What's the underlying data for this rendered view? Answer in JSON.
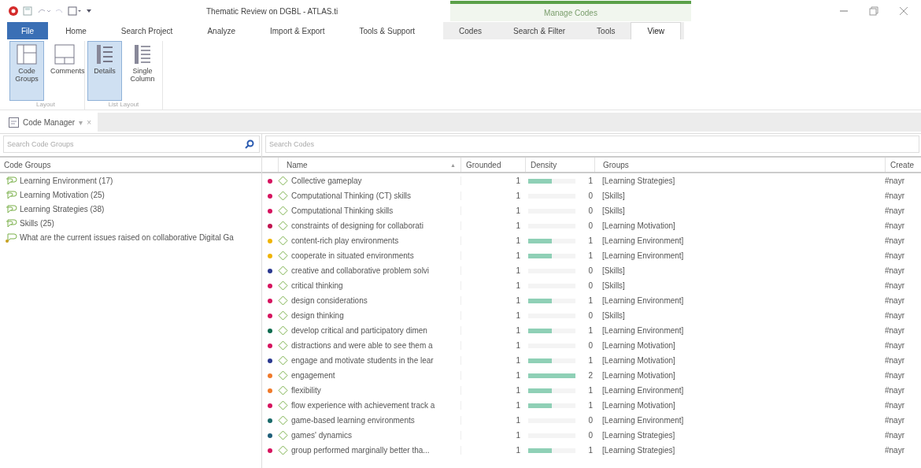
{
  "window": {
    "title": "Thematic Review on DGBL - ATLAS.ti"
  },
  "ribbon_tabs": [
    {
      "label": "File",
      "kind": "file",
      "selected": false
    },
    {
      "label": "Home",
      "kind": "tab",
      "selected": false
    },
    {
      "label": "Search Project",
      "kind": "tab",
      "selected": false
    },
    {
      "label": "Analyze",
      "kind": "tab",
      "selected": false
    },
    {
      "label": "Import & Export",
      "kind": "tab",
      "selected": false
    },
    {
      "label": "Tools & Support",
      "kind": "tab",
      "selected": false
    },
    {
      "label": "Codes",
      "kind": "context",
      "selected": false
    },
    {
      "label": "Search & Filter",
      "kind": "context",
      "selected": false
    },
    {
      "label": "Tools",
      "kind": "context",
      "selected": false
    },
    {
      "label": "View",
      "kind": "context",
      "selected": true
    }
  ],
  "context_group": "Manage Codes",
  "ribbon_groups": [
    {
      "label": "Layout",
      "buttons": [
        {
          "label": "Code Groups",
          "selected": true
        },
        {
          "label": "Comments",
          "selected": false
        }
      ]
    },
    {
      "label": "List Layout",
      "buttons": [
        {
          "label": "Details",
          "selected": true
        },
        {
          "label": "Single Column",
          "selected": false
        }
      ]
    }
  ],
  "document_tab": {
    "label": "Code Manager",
    "pin": "▾",
    "close": "×"
  },
  "code_groups_panel": {
    "search": {
      "placeholder": "Search Code Groups"
    },
    "column": "Code Groups",
    "items": [
      {
        "label": "Learning Environment (17)",
        "kind": "group"
      },
      {
        "label": "Learning Motivation (25)",
        "kind": "group"
      },
      {
        "label": "Learning Strategies (38)",
        "kind": "group"
      },
      {
        "label": "Skills (25)",
        "kind": "group"
      },
      {
        "label": "What are the current issues raised on collaborative Digital Ga",
        "kind": "smart"
      }
    ]
  },
  "codes_panel": {
    "search": {
      "placeholder": "Search Codes"
    },
    "columns": [
      {
        "label": "Name",
        "sort": "▲"
      },
      {
        "label": "Grounded"
      },
      {
        "label": "Density"
      },
      {
        "label": "Groups"
      },
      {
        "label": "Create"
      }
    ],
    "rows": [
      {
        "color": "#d6145f",
        "name": "Collective gameplay",
        "grounded": "1",
        "level": 0.5,
        "density": "1",
        "groups": "[Learning Strategies]",
        "creator": "#nayr"
      },
      {
        "color": "#d6145f",
        "name": "Computational Thinking (CT) skills",
        "grounded": "1",
        "density": "0",
        "groups": "[Skills]",
        "creator": "#nayr"
      },
      {
        "color": "#d6145f",
        "name": "Computational Thinking skills",
        "grounded": "1",
        "density": "0",
        "groups": "[Skills]",
        "creator": "#nayr"
      },
      {
        "color": "#c0144f",
        "name": "constraints of designing for collaborati",
        "grounded": "1",
        "density": "0",
        "groups": "[Learning Motivation]",
        "creator": "#nayr"
      },
      {
        "color": "#f0b400",
        "name": "content-rich play environments",
        "grounded": "1",
        "level": 0.5,
        "density": "1",
        "groups": "[Learning Environment]",
        "creator": "#nayr"
      },
      {
        "color": "#f0b400",
        "name": "cooperate in situated environments",
        "grounded": "1",
        "level": 0.5,
        "density": "1",
        "groups": "[Learning Environment]",
        "creator": "#nayr"
      },
      {
        "color": "#2b3990",
        "name": "creative and collaborative problem solvi",
        "grounded": "1",
        "density": "0",
        "groups": "[Skills]",
        "creator": "#nayr"
      },
      {
        "color": "#d6145f",
        "name": "critical thinking",
        "grounded": "1",
        "density": "0",
        "groups": "[Skills]",
        "creator": "#nayr"
      },
      {
        "color": "#d6145f",
        "name": "design considerations",
        "grounded": "1",
        "level": 0.5,
        "density": "1",
        "groups": "[Learning Environment]",
        "creator": "#nayr"
      },
      {
        "color": "#d6145f",
        "name": "design thinking",
        "grounded": "1",
        "density": "0",
        "groups": "[Skills]",
        "creator": "#nayr"
      },
      {
        "color": "#0f6b4f",
        "name": "develop critical and participatory dimen",
        "grounded": "1",
        "level": 0.5,
        "density": "1",
        "groups": "[Learning Environment]",
        "creator": "#nayr"
      },
      {
        "color": "#d6145f",
        "name": "distractions and were able to see them a",
        "grounded": "1",
        "density": "0",
        "groups": "[Learning Motivation]",
        "creator": "#nayr"
      },
      {
        "color": "#2b3990",
        "name": "engage and motivate students in the lear",
        "grounded": "1",
        "level": 0.5,
        "density": "1",
        "groups": "[Learning Motivation]",
        "creator": "#nayr"
      },
      {
        "color": "#f07a2a",
        "name": "engagement",
        "grounded": "1",
        "level": 1,
        "density": "2",
        "groups": "[Learning Motivation]",
        "creator": "#nayr"
      },
      {
        "color": "#f07a2a",
        "name": "flexibility",
        "grounded": "1",
        "level": 0.5,
        "density": "1",
        "groups": "[Learning Environment]",
        "creator": "#nayr"
      },
      {
        "color": "#d6145f",
        "name": "flow experience with achievement track a",
        "grounded": "1",
        "level": 0.5,
        "density": "1",
        "groups": "[Learning Motivation]",
        "creator": "#nayr"
      },
      {
        "color": "#1a6a6a",
        "name": "game-based learning environments",
        "grounded": "1",
        "density": "0",
        "groups": "[Learning Environment]",
        "creator": "#nayr"
      },
      {
        "color": "#1f5f7a",
        "name": "games' dynamics",
        "grounded": "1",
        "density": "0",
        "groups": "[Learning Strategies]",
        "creator": "#nayr"
      },
      {
        "color": "#d6145f",
        "name": "group performed marginally better tha...",
        "grounded": "1",
        "level": 0.5,
        "density": "1",
        "groups": "[Learning Strategies]",
        "creator": "#nayr"
      }
    ]
  }
}
